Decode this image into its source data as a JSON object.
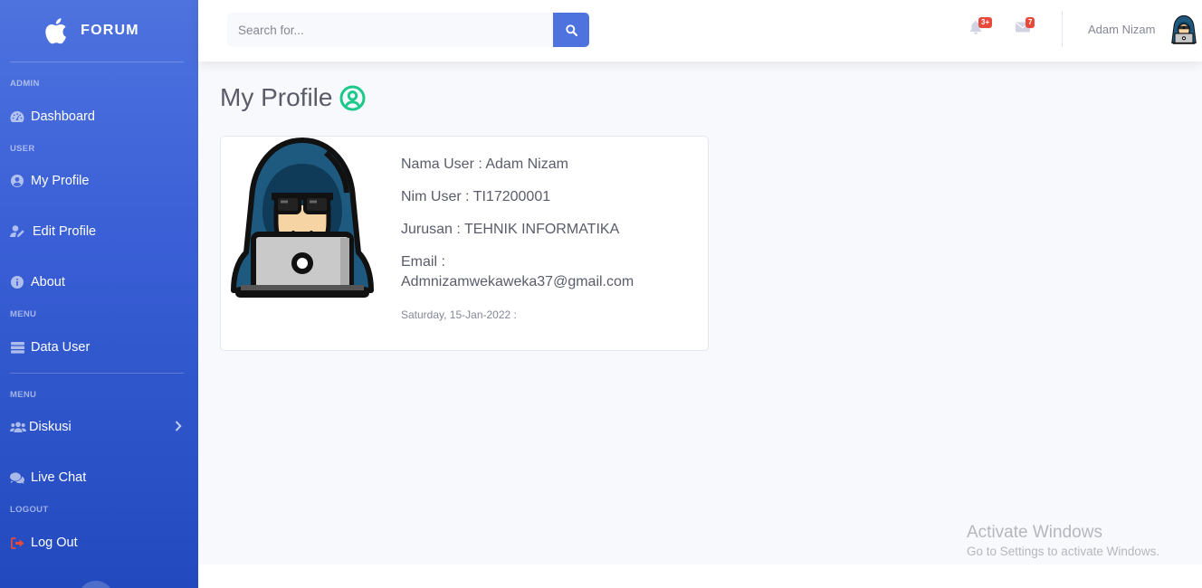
{
  "brand": {
    "name": "FORUM",
    "icon": "apple-icon"
  },
  "sidebar": {
    "sections": [
      {
        "heading": "ADMIN",
        "items": [
          {
            "label": "Dashboard",
            "icon": "dashboard-icon"
          }
        ]
      },
      {
        "heading": "USER",
        "items": [
          {
            "label": "My Profile",
            "icon": "user-circle-icon"
          },
          {
            "label": "Edit Profile",
            "icon": "user-edit-icon"
          },
          {
            "label": "About",
            "icon": "info-icon"
          }
        ]
      },
      {
        "heading": "MENU",
        "items": [
          {
            "label": "Data User",
            "icon": "table-icon"
          }
        ]
      },
      {
        "heading": "MENU",
        "items": [
          {
            "label": "Diskusi",
            "icon": "users-icon"
          },
          {
            "label": "Live Chat",
            "icon": "comments-icon"
          }
        ]
      },
      {
        "heading": "LOGOUT",
        "items": [
          {
            "label": "Log Out",
            "icon": "sign-out-icon"
          }
        ]
      }
    ]
  },
  "topbar": {
    "search_placeholder": "Search for...",
    "alerts_badge": "3+",
    "messages_badge": "7",
    "user_name": "Adam Nizam"
  },
  "page": {
    "title": "My Profile"
  },
  "profile": {
    "nama": "Nama User : Adam Nizam",
    "nim": "Nim User : TI17200001",
    "jurusan": "Jurusan : TEHNIK INFORMATIKA",
    "email_label": "Email :",
    "email": "Admnizamwekaweka37@gmail.com",
    "date": "Saturday, 15-Jan-2022 :"
  },
  "watermark": {
    "line1": "Activate Windows",
    "line2": "Go to Settings to activate Windows."
  },
  "colors": {
    "primary": "#4e73df",
    "success": "#1cc88a",
    "danger": "#e74a3b"
  }
}
